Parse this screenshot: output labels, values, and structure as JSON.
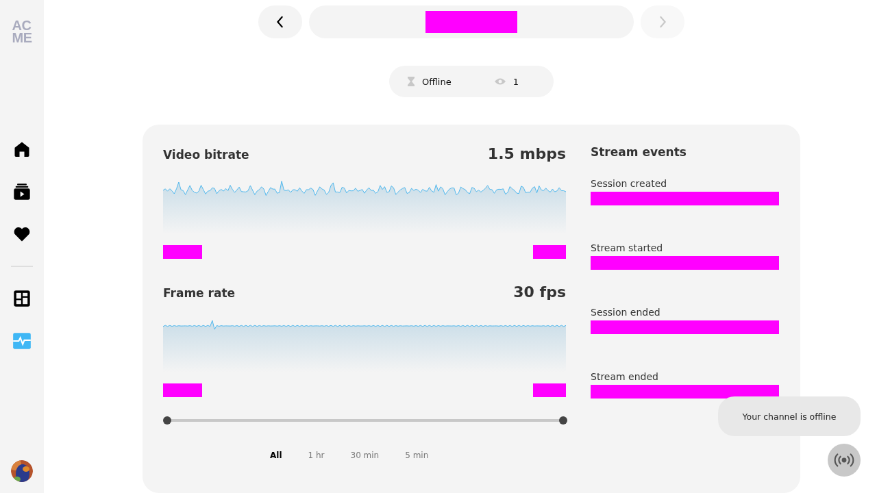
{
  "sidebar": {
    "logo": [
      "AC",
      "ME"
    ],
    "items": [
      {
        "kind": "home",
        "selected": false
      },
      {
        "kind": "library",
        "selected": false
      },
      {
        "kind": "heart",
        "selected": false
      },
      {
        "kind": "dashboard",
        "selected": false
      },
      {
        "kind": "activity",
        "selected": true
      }
    ]
  },
  "nav": {
    "back_disabled": false,
    "forward_disabled": true
  },
  "status": {
    "state": "Offline",
    "viewers": "1"
  },
  "metrics": [
    {
      "title": "Video bitrate",
      "value": "1.5 mbps",
      "kind": "noisy"
    },
    {
      "title": "Frame rate",
      "value": "30 fps",
      "kind": "flat"
    }
  ],
  "range_slider": {
    "level": 1
  },
  "time_filters": [
    {
      "label": "All",
      "selected": true
    },
    {
      "label": "1 hr",
      "selected": false
    },
    {
      "label": "30 min",
      "selected": false
    },
    {
      "label": "5 min",
      "selected": false
    }
  ],
  "events": {
    "title": "Stream events",
    "items": [
      "Session created",
      "Stream started",
      "Session ended",
      "Stream ended"
    ]
  },
  "toast": "Your channel is offline"
}
